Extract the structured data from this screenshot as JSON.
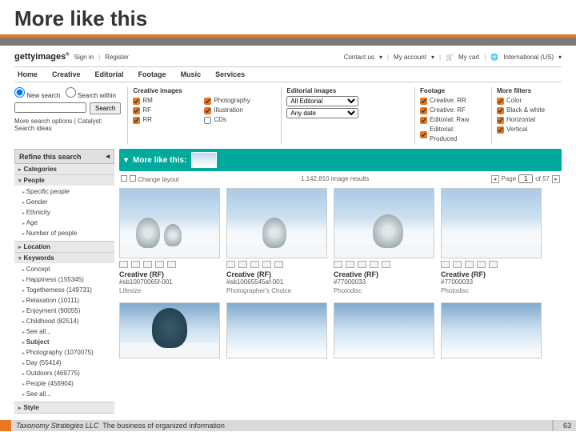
{
  "slide": {
    "title": "More like this"
  },
  "header": {
    "logo": "gettyimages",
    "signin": "Sign in",
    "register": "Register",
    "contact": "Contact us",
    "my_account": "My account",
    "my_cart": "My cart",
    "locale": "International (US)"
  },
  "nav": [
    "Home",
    "Creative",
    "Editorial",
    "Footage",
    "Music",
    "Services"
  ],
  "search": {
    "new_search": "New search",
    "search_within": "Search within",
    "button": "Search",
    "placeholder": "",
    "more": "More search options | Catalyst: Search ideas"
  },
  "filters": {
    "creative_images": {
      "head": "Creative images",
      "items": [
        "RM",
        "RF",
        "RR"
      ]
    },
    "creative_images2": {
      "items": [
        "Photography",
        "Illustration",
        "CDs"
      ]
    },
    "editorial_images": {
      "head": "Editorial images",
      "sel1": "All Editorial",
      "sel2": "Any date"
    },
    "footage": {
      "head": "Footage",
      "items": [
        "Creative: RR",
        "Creative: RF",
        "Editorial: Raw",
        "Editorial: Produced"
      ]
    },
    "more": {
      "head": "More filters",
      "items": [
        "Color",
        "Black & white",
        "Horizontal",
        "Vertical"
      ]
    }
  },
  "refine": {
    "head": "Refine this search",
    "sections": [
      {
        "name": "Categories",
        "items": []
      },
      {
        "name": "People",
        "items": [
          "Specific people",
          "Gender",
          "Ethnicity",
          "Age",
          "Number of people"
        ]
      },
      {
        "name": "Location",
        "items": []
      },
      {
        "name": "Keywords",
        "items_a": [
          "Concept",
          "Happiness (155345)",
          "Togetherness (149731)",
          "Relaxation (10111)",
          "Enjoyment (90055)",
          "Childhood (82514)",
          "See all..."
        ],
        "items_b_head": "Subject",
        "items_b": [
          "Photography (1070075)",
          "Day (55414)",
          "Outdoors (469775)",
          "People (456904)",
          "See all..."
        ]
      },
      {
        "name": "Style",
        "items": []
      }
    ]
  },
  "mlt": {
    "label": "More like this:"
  },
  "toolbar": {
    "change_layout": "Change layout",
    "result_count": "1,142,810 image results",
    "page_label": "Page",
    "page_value": "1",
    "page_total": "of 57"
  },
  "cards": [
    {
      "title": "Creative (RF)",
      "id": "#sb10070065f-001",
      "coll": "Lifesize"
    },
    {
      "title": "Creative (RF)",
      "id": "#sb10065545af-001",
      "coll": "Photographer's Choice"
    },
    {
      "title": "Creative (RF)",
      "id": "#77000033",
      "coll": "Photodisc"
    },
    {
      "title": "Creative (RF)",
      "id": "#77000033",
      "coll": "Photodisc"
    }
  ],
  "footer": {
    "company": "Taxonomy Strategies LLC",
    "tagline": "The business of organized information",
    "page": "63"
  }
}
